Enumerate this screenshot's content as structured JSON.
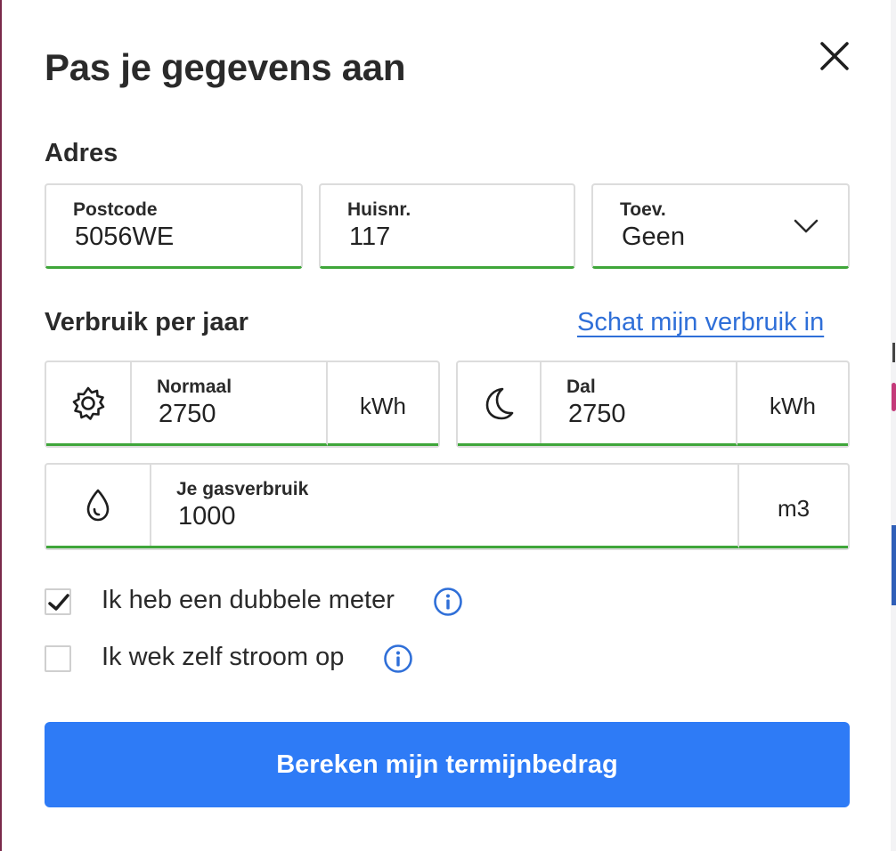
{
  "modal": {
    "title": "Pas je gegevens aan"
  },
  "address": {
    "section_label": "Adres",
    "postcode": {
      "label": "Postcode",
      "value": "5056WE"
    },
    "house_number": {
      "label": "Huisnr.",
      "value": "117"
    },
    "addition": {
      "label": "Toev.",
      "selected": "Geen"
    }
  },
  "usage": {
    "section_label": "Verbruik per jaar",
    "estimate_link": "Schat mijn verbruik in",
    "normal": {
      "label": "Normaal",
      "value": "2750",
      "unit": "kWh",
      "icon": "sun-icon"
    },
    "off_peak": {
      "label": "Dal",
      "value": "2750",
      "unit": "kWh",
      "icon": "moon-icon"
    },
    "gas": {
      "label": "Je gasverbruik",
      "value": "1000",
      "unit": "m3",
      "icon": "flame-icon"
    }
  },
  "options": {
    "double_meter": {
      "label": "Ik heb een dubbele meter",
      "checked": true
    },
    "generate_power": {
      "label": "Ik wek zelf stroom op",
      "checked": false
    }
  },
  "submit": {
    "label": "Bereken mijn termijnbedrag"
  },
  "colors": {
    "accent": "#2e7bf6",
    "link": "#2f6fd8",
    "valid_border": "#3fa63a"
  }
}
